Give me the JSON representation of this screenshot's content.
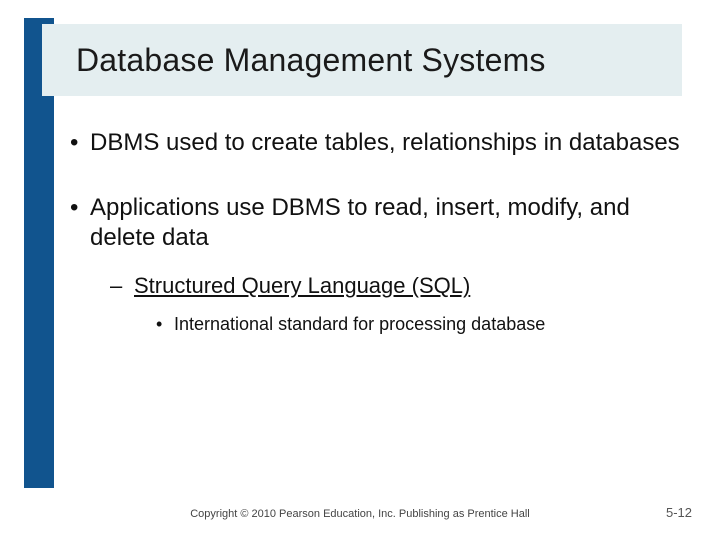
{
  "slide": {
    "title": "Database Management Systems",
    "bullets": [
      {
        "text": "DBMS used to create tables, relationships in databases"
      },
      {
        "text": "Applications use DBMS to read, insert, modify, and delete data",
        "sub": [
          {
            "text": "Structured Query Language (SQL)",
            "underline": true,
            "sub": [
              {
                "text": "International standard for processing database"
              }
            ]
          }
        ]
      }
    ],
    "footer": "Copyright © 2010 Pearson Education, Inc. Publishing as Prentice Hall",
    "page": "5-12"
  }
}
